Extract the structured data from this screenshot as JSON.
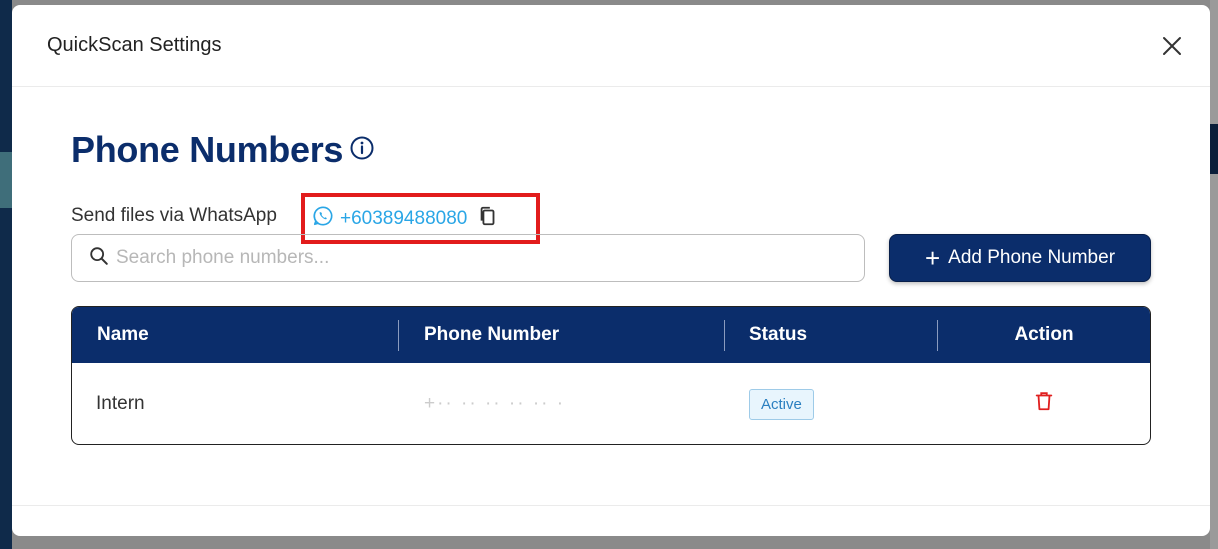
{
  "modal": {
    "title": "QuickScan Settings"
  },
  "page": {
    "title": "Phone Numbers"
  },
  "whatsapp": {
    "label": "Send files via WhatsApp",
    "number": "+60389488080"
  },
  "search": {
    "placeholder": "Search phone numbers..."
  },
  "add_button": {
    "label": "Add Phone Number"
  },
  "table": {
    "headers": [
      "Name",
      "Phone Number",
      "Status",
      "Action"
    ],
    "rows": [
      {
        "name": "Intern",
        "phone": "+·· ·· ·· ·· ·· · ",
        "status": "Active"
      }
    ]
  },
  "colors": {
    "primary": "#0b2d6b",
    "accent": "#2aa6e6",
    "highlight": "#e21c1c",
    "delete": "#e02020"
  },
  "icons": {
    "close": "close-icon",
    "info": "info-icon",
    "whatsapp": "whatsapp-icon",
    "copy": "copy-icon",
    "search": "search-icon",
    "plus": "plus-icon",
    "delete": "trash-icon"
  }
}
